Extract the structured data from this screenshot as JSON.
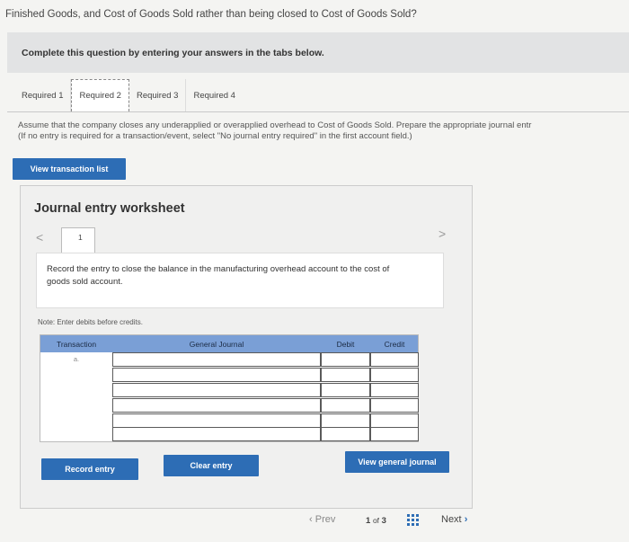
{
  "header": {
    "question_text": "Finished Goods, and Cost of Goods Sold rather than being closed to Cost of Goods Sold?"
  },
  "banner": {
    "text": "Complete this question by entering your answers in the tabs below."
  },
  "tabs": [
    {
      "label": "Required 1",
      "active": false
    },
    {
      "label": "Required 2",
      "active": true
    },
    {
      "label": "Required 3",
      "active": false
    },
    {
      "label": "Required 4",
      "active": false
    }
  ],
  "instructions": {
    "line1": "Assume that the company closes any underapplied or overapplied overhead to Cost of Goods Sold. Prepare the appropriate journal entr",
    "line2": "(If no entry is required for a transaction/event, select \"No journal entry required\" in the first account field.)"
  },
  "buttons": {
    "view_transactions": "View transaction list",
    "record_entry": "Record entry",
    "clear_entry": "Clear entry",
    "view_general_journal": "View general journal"
  },
  "worksheet": {
    "title": "Journal entry worksheet",
    "prev_symbol": "<",
    "next_symbol": ">",
    "page_tab": "1",
    "prompt": "Record the entry to close the balance in the manufacturing overhead account to the cost of goods sold account.",
    "note": "Note: Enter debits before credits."
  },
  "table": {
    "columns": {
      "transaction": "Transaction",
      "general_journal": "General Journal",
      "debit": "Debit",
      "credit": "Credit"
    },
    "rows": [
      {
        "transaction": "a.",
        "account": "",
        "debit": "",
        "credit": ""
      },
      {
        "transaction": "",
        "account": "",
        "debit": "",
        "credit": ""
      },
      {
        "transaction": "",
        "account": "",
        "debit": "",
        "credit": ""
      },
      {
        "transaction": "",
        "account": "",
        "debit": "",
        "credit": ""
      },
      {
        "transaction": "",
        "account": "",
        "debit": "",
        "credit": ""
      },
      {
        "transaction": "",
        "account": "",
        "debit": "",
        "credit": ""
      }
    ]
  },
  "pagination": {
    "prev_label": "Prev",
    "current": "1",
    "of_label": "of",
    "total": "3",
    "next_label": "Next",
    "grid_icon": "grid-icon"
  },
  "colors": {
    "button_blue": "#2d6db5",
    "table_header": "#7a9fd6"
  }
}
